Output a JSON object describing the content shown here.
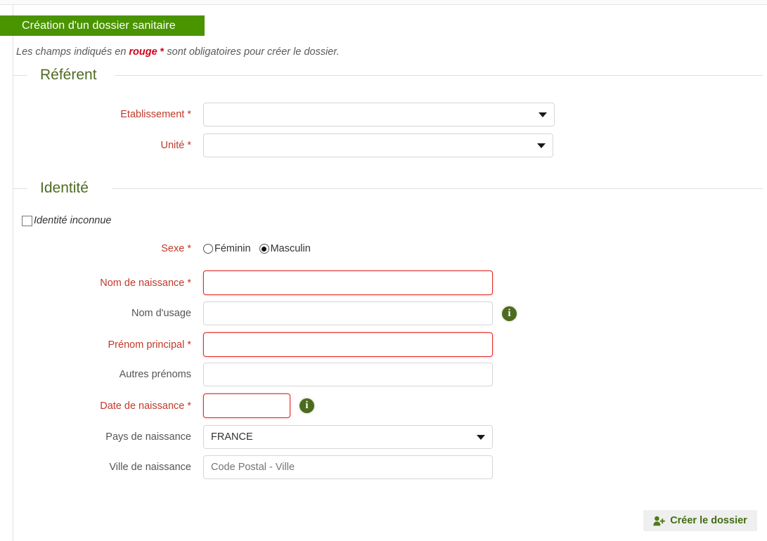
{
  "header": {
    "tab_title": "Création d'un dossier sanitaire",
    "hint_prefix": "Les champs indiqués en ",
    "hint_rouge": "rouge",
    "hint_star": " * ",
    "hint_suffix": "sont obligatoires pour créer le dossier."
  },
  "sections": {
    "referent": {
      "legend": "Référent",
      "fields": {
        "etablissement": {
          "label": "Etablissement",
          "required_marker": " *",
          "value": "",
          "type": "select"
        },
        "unite": {
          "label": "Unité",
          "required_marker": " *",
          "value": "",
          "type": "select"
        }
      }
    },
    "identite": {
      "legend": "Identité",
      "unknown_identity": {
        "label": "Identité inconnue",
        "checked": false
      },
      "fields": {
        "sexe": {
          "label": "Sexe",
          "required_marker": " *",
          "options": [
            {
              "label": "Féminin",
              "checked": false
            },
            {
              "label": "Masculin",
              "checked": true
            }
          ]
        },
        "nom_naissance": {
          "label": "Nom de naissance",
          "required_marker": " *",
          "value": "",
          "placeholder": ""
        },
        "nom_usage": {
          "label": "Nom d'usage",
          "required_marker": "",
          "value": "",
          "placeholder": ""
        },
        "prenom_principal": {
          "label": "Prénom principal",
          "required_marker": " *",
          "value": "",
          "placeholder": ""
        },
        "autres_prenoms": {
          "label": "Autres prénoms",
          "required_marker": "",
          "value": "",
          "placeholder": ""
        },
        "date_naissance": {
          "label": "Date de naissance",
          "required_marker": " *",
          "value": "",
          "placeholder": ""
        },
        "pays_naissance": {
          "label": "Pays de naissance",
          "required_marker": "",
          "value": "FRANCE",
          "type": "select"
        },
        "ville_naissance": {
          "label": "Ville de naissance",
          "required_marker": "",
          "value": "",
          "placeholder": "Code Postal - Ville"
        }
      }
    }
  },
  "footer": {
    "submit_label": "Créer le dossier",
    "submit_icon": "user-plus-icon"
  },
  "colors": {
    "brand_green": "#4a9400",
    "legend_green": "#4f6b23",
    "required_red": "#c0392b",
    "required_border": "#e02b27",
    "hint_red": "#d0021b",
    "info_icon_green": "#4c6b1f",
    "button_text_green": "#3f6d12",
    "button_bg": "#efefef"
  }
}
